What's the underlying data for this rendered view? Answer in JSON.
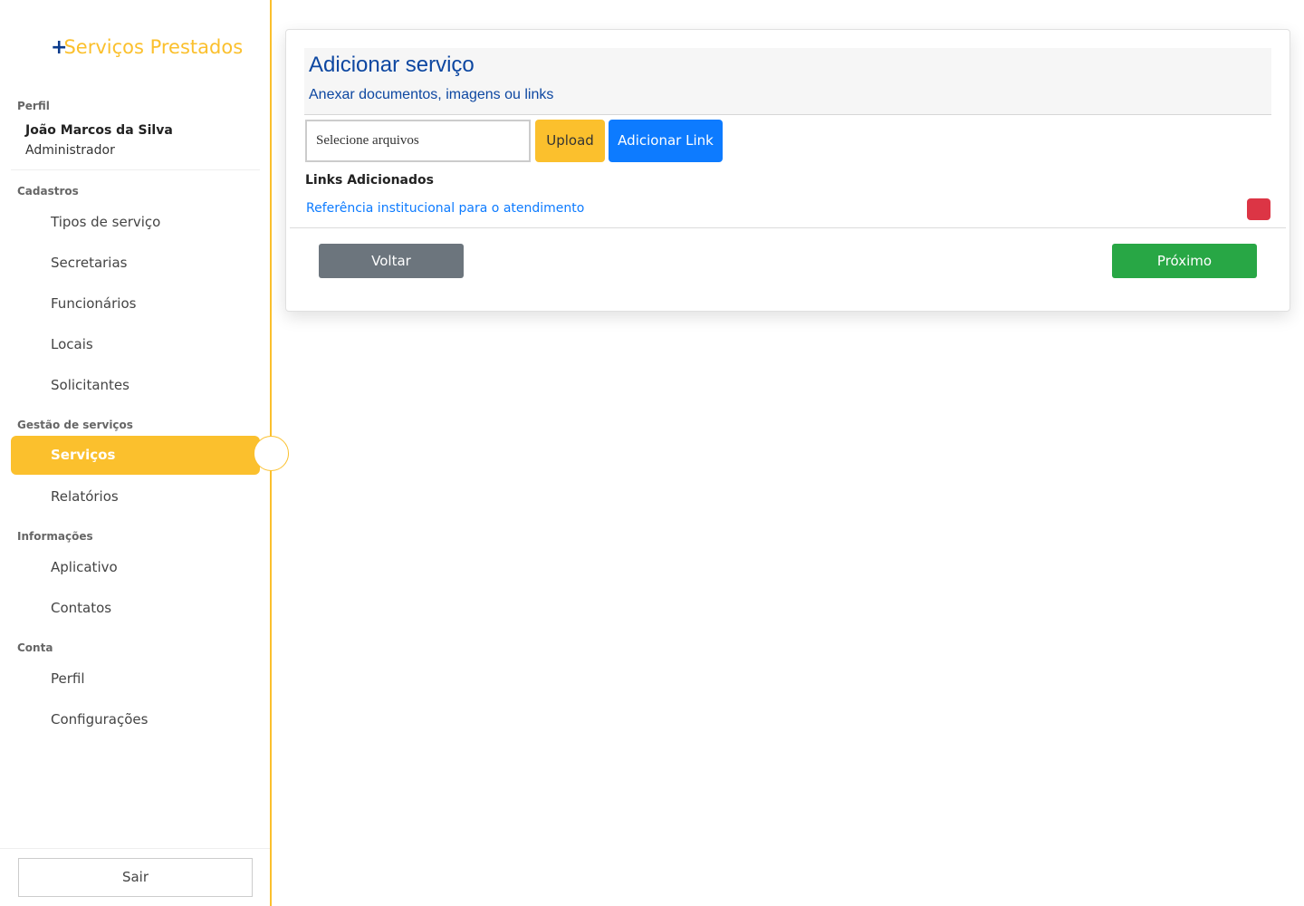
{
  "app": {
    "logo_plus": "+",
    "logo_text": "Serviços Prestados"
  },
  "sidebar": {
    "profile_section": "Perfil",
    "user_name": "João Marcos da Silva",
    "user_role": "Administrador",
    "sections": [
      {
        "label": "Cadastros",
        "items": [
          "Tipos de serviço",
          "Secretarias",
          "Funcionários",
          "Locais",
          "Solicitantes"
        ]
      },
      {
        "label": "Gestão de serviços",
        "items": [
          "Serviços",
          "Relatórios"
        ]
      },
      {
        "label": "Informações",
        "items": [
          "Aplicativo",
          "Contatos"
        ]
      },
      {
        "label": "Conta",
        "items": [
          "Perfil",
          "Configurações"
        ]
      }
    ],
    "active_item": "Serviços",
    "logout_label": "Sair"
  },
  "main": {
    "title": "Adicionar serviço",
    "subtitle": "Anexar documentos, imagens ou links",
    "file_input_label": "Selecione arquivos",
    "upload_label": "Upload",
    "add_link_label": "Adicionar Link",
    "links_heading": "Links Adicionados",
    "links": [
      "Referência institucional para o atendimento"
    ],
    "back_label": "Voltar",
    "next_label": "Próximo"
  },
  "colors": {
    "accent": "#fbc02d",
    "brand_blue": "#0d47a1",
    "primary": "#0d7bff",
    "danger": "#dc3545",
    "success": "#28a745",
    "secondary": "#6c757d"
  }
}
